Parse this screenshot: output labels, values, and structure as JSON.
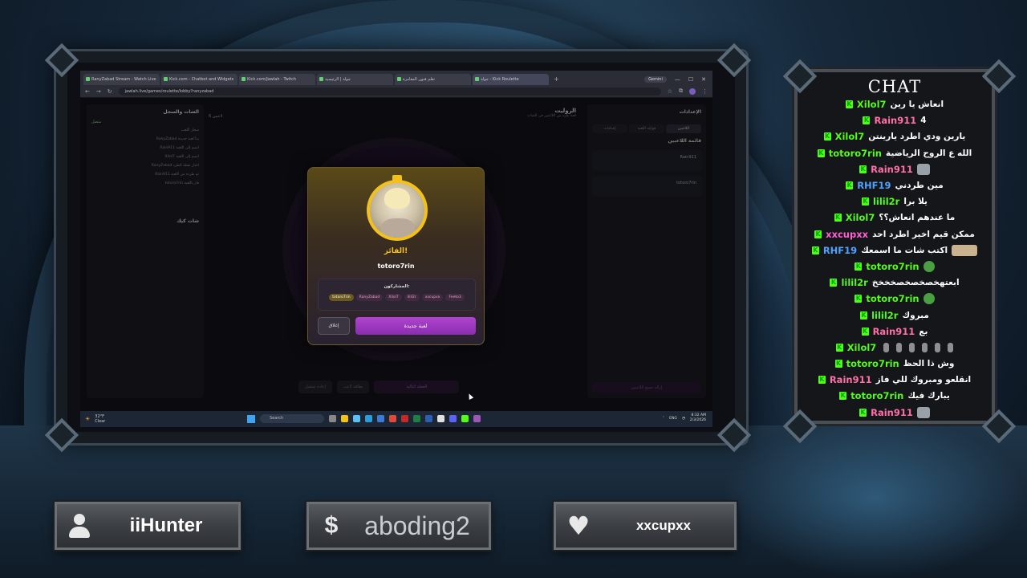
{
  "browser": {
    "tabs": [
      {
        "label": "RanyZabad Stream - Watch Live"
      },
      {
        "label": "Kick.com - Chatbot and Widgets"
      },
      {
        "label": "Kick.com/Jawlah - Twitch"
      },
      {
        "label": "جولة | الرئيسية"
      },
      {
        "label": "تعلم فنون المغامرة"
      },
      {
        "label": "جولة - Kick Roulette",
        "active": true
      }
    ],
    "gemini_label": "Gemini",
    "url": "jawlah.live/games/roulette/lobby?ranyzabad"
  },
  "app": {
    "left_panel_title": "الشات والسجل",
    "left_panel_status": "متصل",
    "log_title": "سجل اللعب",
    "log_lines": [
      "RanyZabad بدأ لعبة جديدة",
      "Rain911 انضم إلى اللعبة",
      "Xilol7 انضم إلى اللعبة",
      "RanyZabad اختار نقطة الطرد",
      "Rain911 تم طرده من اللعبة",
      "totoro7rin فاز باللعبة"
    ],
    "chat_title": "شات كيك",
    "game_title": "الروليت",
    "game_subtitle": "لعبة طرد بين اللاعبين في الشات",
    "players_count": "6 لاعبين",
    "settings_label": "الإعدادات",
    "right_tabs": [
      "اللاعبين",
      "قواعد اللعبة",
      "إعدادات"
    ],
    "players_list_title": "قائمة اللاعبين",
    "player_rows": [
      "Rain911",
      "totoro7rin"
    ],
    "center_buttons": {
      "main": "العجلة التالية",
      "b2": "بطاقة لاعب",
      "b3": "إعادة تشغيل"
    },
    "reset_label": "إزالة جميع اللاعبين"
  },
  "modal": {
    "winner_label": "الفائز!",
    "winner_name": "totoro7rin",
    "participants_title": "المشاركون:",
    "participants": [
      "totoro7rin",
      "RanyZabad",
      "Xilol7",
      "lilil2r",
      "xxcupxx",
      "Feeto3"
    ],
    "close_label": "إغلاق",
    "new_game_label": "لعبة جديدة"
  },
  "taskbar": {
    "weather_temp": "32°F",
    "weather_desc": "Clear",
    "search_placeholder": "Search",
    "lang": "ENG",
    "time": "8:32 AM",
    "date": "2/3/2026"
  },
  "chat": {
    "title": "CHAT",
    "messages": [
      {
        "user": "Xilol7",
        "color": "#53fc18",
        "text": "انعاش يا رين",
        "emote": ""
      },
      {
        "user": "Rain911",
        "color": "#ff6fa8",
        "text": "4",
        "emote": ""
      },
      {
        "user": "Xilol7",
        "color": "#53fc18",
        "text": "يارين ودي اطرد يارينتن",
        "emote": ""
      },
      {
        "user": "totoro7rin",
        "color": "#53fc18",
        "text": "الله ع الروح الرياضية",
        "emote": ""
      },
      {
        "user": "Rain911",
        "color": "#ff6fa8",
        "text": "",
        "emote": "cat"
      },
      {
        "user": "RHF19",
        "color": "#4fa3ff",
        "text": "مين طردني",
        "emote": ""
      },
      {
        "user": "lilil2r",
        "color": "#53fc18",
        "text": "يلا برا",
        "emote": ""
      },
      {
        "user": "Xilol7",
        "color": "#53fc18",
        "text": "ما عندهم انعاش؟؟",
        "emote": ""
      },
      {
        "user": "xxcupxx",
        "color": "#ff5fd0",
        "text": "ممكن قيم اخير اطرد احد",
        "emote": ""
      },
      {
        "user": "RHF19",
        "color": "#4fa3ff",
        "text": "اكتب شات ما اسمعك",
        "emote": "faces"
      },
      {
        "user": "totoro7rin",
        "color": "#53fc18",
        "text": "",
        "emote": "frog"
      },
      {
        "user": "lilil2r",
        "color": "#53fc18",
        "text": "ابعتهخصخصخصخخخخ",
        "emote": ""
      },
      {
        "user": "totoro7rin",
        "color": "#53fc18",
        "text": "",
        "emote": "frog"
      },
      {
        "user": "lilil2r",
        "color": "#53fc18",
        "text": "مبروك",
        "emote": ""
      },
      {
        "user": "Rain911",
        "color": "#ff6fa8",
        "text": "بع",
        "emote": ""
      },
      {
        "user": "Xilol7",
        "color": "#53fc18",
        "text": "",
        "emote": "dancers"
      },
      {
        "user": "totoro7rin",
        "color": "#53fc18",
        "text": "وش ذا الحظ",
        "emote": ""
      },
      {
        "user": "Rain911",
        "color": "#ff6fa8",
        "text": "انقلعو ومبروك للي فاز",
        "emote": ""
      },
      {
        "user": "totoro7rin",
        "color": "#53fc18",
        "text": "يبارك فيك",
        "emote": ""
      },
      {
        "user": "Rain911",
        "color": "#ff6fa8",
        "text": "",
        "emote": "cat"
      }
    ]
  },
  "plaques": {
    "follower": "iiHunter",
    "donation": "aboding2",
    "subscriber": "xxcupxx"
  }
}
